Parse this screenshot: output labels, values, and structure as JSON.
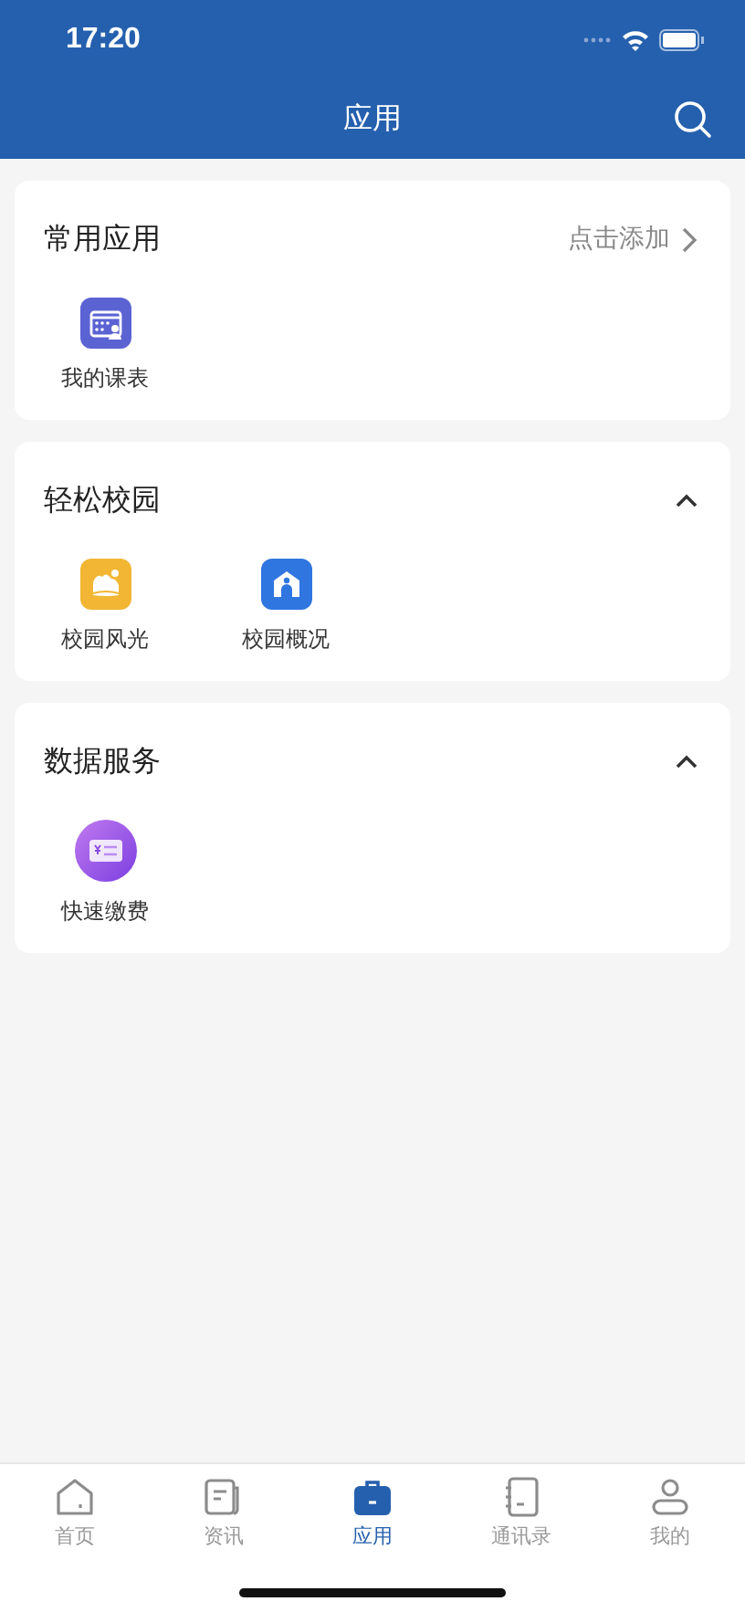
{
  "status_bar": {
    "time": "17:20"
  },
  "nav_bar": {
    "title": "应用"
  },
  "sections": [
    {
      "title": "常用应用",
      "action": {
        "kind": "link",
        "label": "点击添加"
      },
      "items": [
        {
          "label": "我的课表",
          "kind": "timetable"
        }
      ]
    },
    {
      "title": "轻松校园",
      "action": {
        "kind": "collapse"
      },
      "expanded": true,
      "items": [
        {
          "label": "校园风光",
          "kind": "scenery"
        },
        {
          "label": "校园概况",
          "kind": "campus"
        }
      ]
    },
    {
      "title": "数据服务",
      "action": {
        "kind": "collapse"
      },
      "expanded": true,
      "items": [
        {
          "label": "快速缴费",
          "kind": "payment"
        }
      ]
    }
  ],
  "tab_bar": [
    {
      "label": "首页",
      "kind": "home",
      "selected": false
    },
    {
      "label": "资讯",
      "kind": "news",
      "selected": false
    },
    {
      "label": "应用",
      "kind": "apps",
      "selected": true
    },
    {
      "label": "通讯录",
      "kind": "contacts",
      "selected": false
    },
    {
      "label": "我的",
      "kind": "profile",
      "selected": false
    }
  ]
}
